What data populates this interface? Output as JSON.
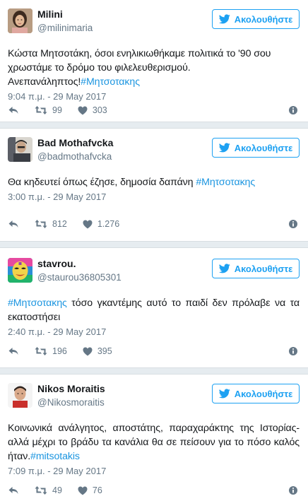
{
  "follow_label": "Ακολουθήστε",
  "tweets": [
    {
      "name": "Milini",
      "handle": "@milinimaria",
      "text_pre": "Κώστα Μητσοτάκη, όσοι ενηλικιωθήκαμε πολιτικά το '90 σου χρωστάμε το δρόμο του φιλελευθερισμού. Ανεπανάληπτος!",
      "hashtag": "#Μητσοτακης",
      "text_post": "",
      "time": "9:04 π.μ. - 29 May 2017",
      "retweets": "99",
      "likes": "303",
      "avatar_icon": "woman-portrait-icon"
    },
    {
      "name": "Bad Mothafvcka",
      "handle": "@badmothafvcka",
      "text_pre": "Θα κηδευτεί όπως έζησε, δημοσία δαπάνη ",
      "hashtag": "#Μητσοτακης",
      "text_post": "",
      "time": "3:00 π.μ. - 29 May 2017",
      "retweets": "812",
      "likes": "1.276",
      "avatar_icon": "man-portrait-icon"
    },
    {
      "name": "stavrou.",
      "handle": "@staurou36805301",
      "text_pre": "",
      "hashtag": "#Μητσοτακης",
      "text_post": " τόσο γκαντέμης αυτό το παιδί δεν πρόλαβε να τα εκατοστήσει",
      "time": "2:40 π.μ. - 29 May 2017",
      "retweets": "196",
      "likes": "395",
      "avatar_icon": "colorful-mask-icon"
    },
    {
      "name": "Nikos Moraitis",
      "handle": "@Nikosmoraitis",
      "text_pre": "Κοινωνικά ανάλγητος, αποστάτης, παραχαράκτης της Ιστορίας- αλλά μέχρι το βράδυ τα κανάλια θα σε πείσουν για το πόσο καλός ήταν.",
      "hashtag": "#mitsotakis",
      "text_post": "",
      "time": "7:09 π.μ. - 29 May 2017",
      "retweets": "49",
      "likes": "76",
      "avatar_icon": "man-portrait-icon"
    }
  ],
  "colors": {
    "accent": "#1da1f2",
    "hashtag": "#1b95e0",
    "muted": "#657786",
    "separator": "#e6ecf0"
  }
}
